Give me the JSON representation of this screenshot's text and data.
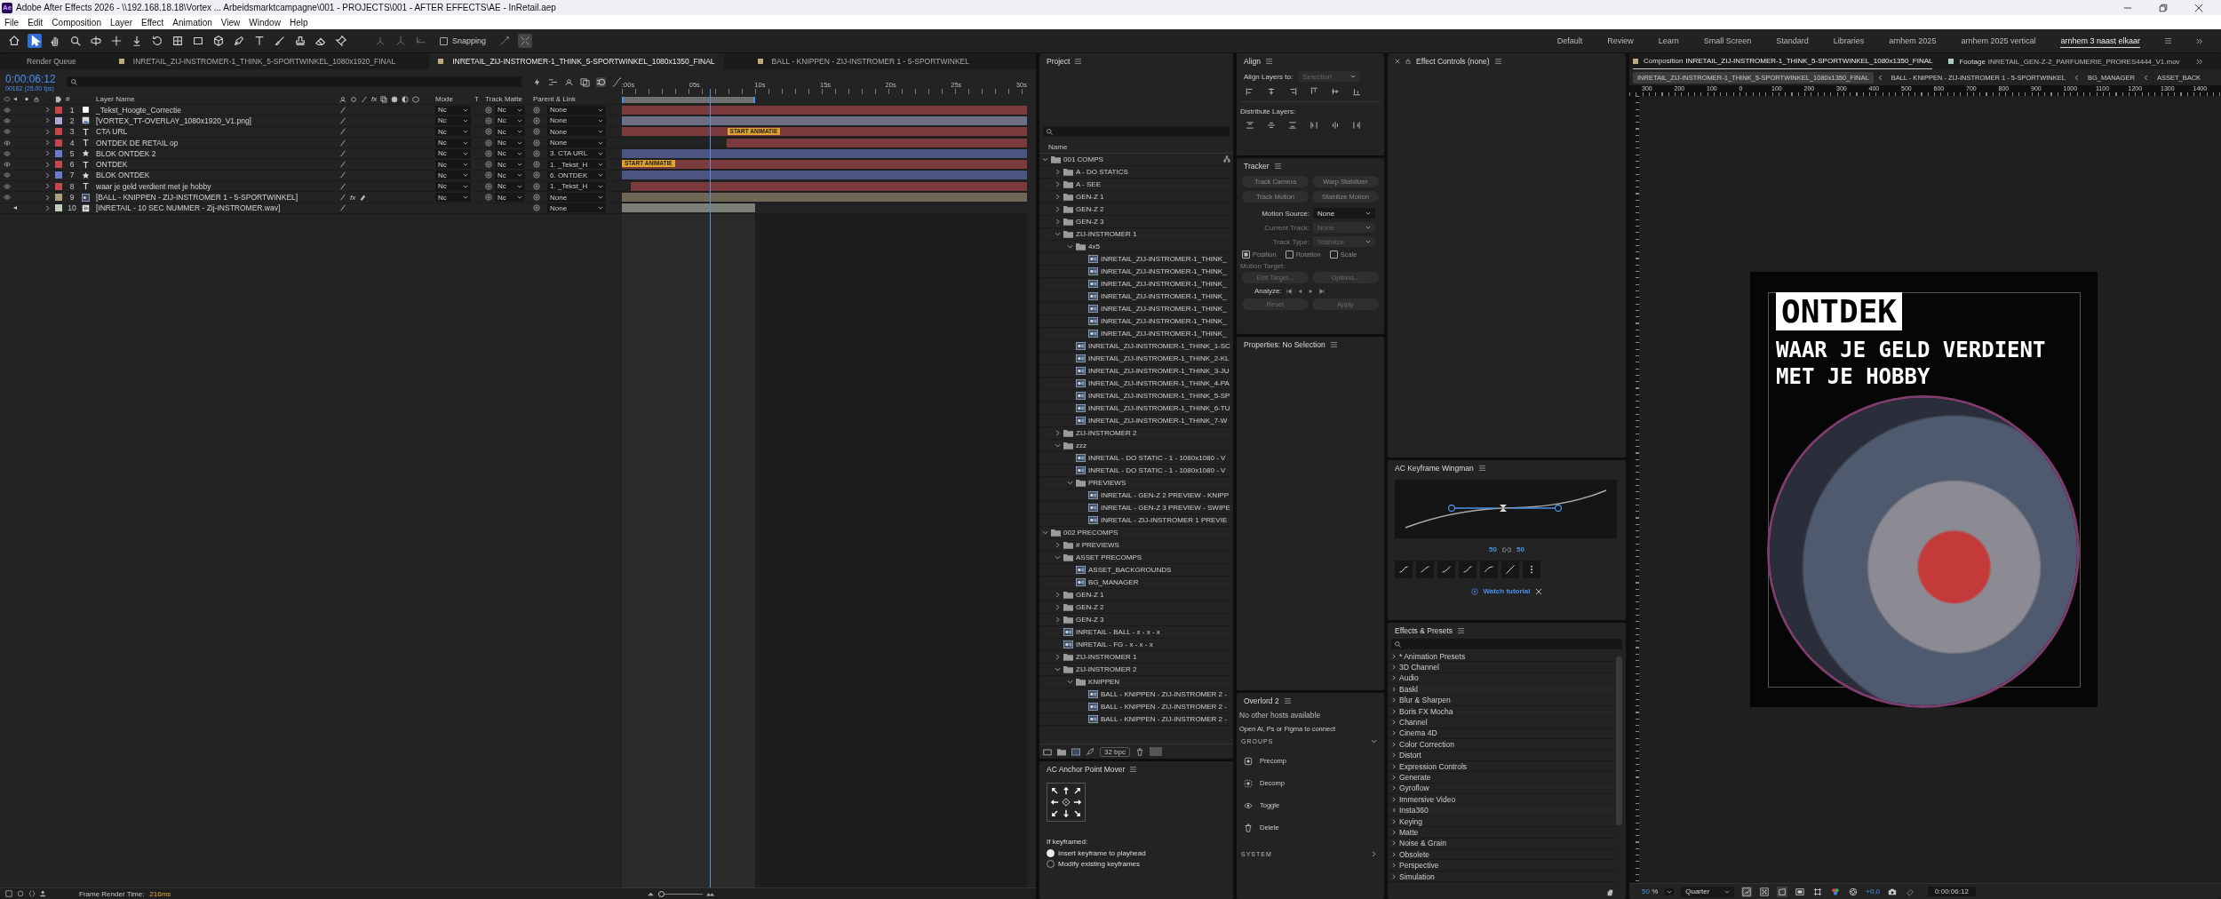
{
  "window": {
    "app_icon": "Ae",
    "title": "Adobe After Effects 2026 - \\\\192.168.18.18\\Vortex ... Arbeidsmarktcampagne\\001 - PROJECTS\\001 - AFTER EFFECTS\\AE - InRetail.aep"
  },
  "menu": [
    "File",
    "Edit",
    "Composition",
    "Layer",
    "Effect",
    "Animation",
    "View",
    "Window",
    "Help"
  ],
  "toolbar": {
    "tools": [
      {
        "selected": false
      },
      {
        "selected": true
      },
      {
        "selected": false
      },
      {
        "selected": false
      },
      {
        "selected": false
      },
      {
        "selected": false
      },
      {
        "selected": false
      },
      {
        "selected": false
      },
      {
        "selected": false
      },
      {
        "selected": false
      },
      {
        "selected": false
      },
      {
        "selected": false
      },
      {
        "selected": false
      },
      {
        "selected": false
      },
      {
        "selected": false
      },
      {
        "selected": false
      },
      {
        "selected": false
      }
    ],
    "snapping": {
      "label": "Snapping",
      "checked": false
    }
  },
  "workspaces": [
    {
      "label": "Default",
      "selected": false
    },
    {
      "label": "Review",
      "selected": false
    },
    {
      "label": "Learn",
      "selected": false
    },
    {
      "label": "Small Screen",
      "selected": false
    },
    {
      "label": "Standard",
      "selected": false
    },
    {
      "label": "Libraries",
      "selected": false
    },
    {
      "label": "arnhem 2025",
      "selected": false
    },
    {
      "label": "arnhem 2025 vertical",
      "selected": false
    },
    {
      "label": "arnhem 3 naast elkaar",
      "selected": true
    }
  ],
  "timeline": {
    "tabs": [
      {
        "label": "Render Queue",
        "kind": "queue",
        "selected": false
      },
      {
        "label": "INRETAIL_ZIJ-INSTROMER-1_THINK_5-SPORTWINKEL_1080x1920_FINAL",
        "kind": "comp",
        "selected": false
      },
      {
        "label": "INRETAIL_ZIJ-INSTROMER-1_THINK_5-SPORTWINKEL_1080x1350_FINAL",
        "kind": "comp",
        "selected": true
      },
      {
        "label": "BALL - KNIPPEN - ZIJ-INSTROMER 1 - 5-SPORTWINKEL",
        "kind": "comp",
        "selected": false
      }
    ],
    "timecode": "0:00:06:12",
    "frame_info": "00162 (25.00 fps)",
    "columns": {
      "number": "#",
      "layer_name": "Layer Name",
      "fx": "fx",
      "mode": "Mode",
      "t": "T",
      "track_matte": "Track Matte",
      "parent": "Parent & Link"
    },
    "ruler": [
      ":00s",
      "05s",
      "10s",
      "15s",
      "20s",
      "25s",
      "30s"
    ],
    "layers": [
      {
        "number": "1",
        "name": "_Tekst_Hoogte_Correctie",
        "kind": "solid",
        "color": "#c4474b",
        "enabled": true,
        "mode": "Nc",
        "matte": "Nc",
        "parent": "None"
      },
      {
        "number": "2",
        "name": "[VORTEX_TT-OVERLAY_1080x1920_V1.png]",
        "kind": "footage",
        "color": "#a9aad4",
        "enabled": true,
        "mode": "Nc",
        "matte": "Nc",
        "parent": "None"
      },
      {
        "number": "3",
        "name": "CTA URL",
        "kind": "text",
        "color": "#c4474b",
        "enabled": true,
        "mode": "Nc",
        "matte": "Nc",
        "parent": "None",
        "marker": "START ANIMATIE"
      },
      {
        "number": "4",
        "name": "ONTDEK DE RETAIL op",
        "kind": "text",
        "color": "#c4474b",
        "enabled": true,
        "mode": "Nc",
        "matte": "Nc",
        "parent": "None"
      },
      {
        "number": "5",
        "name": "BLOK ONTDEK 2",
        "kind": "shape",
        "color": "#6b7ad1",
        "enabled": true,
        "mode": "Nc",
        "matte": "Nc",
        "parent": "3. CTA URL"
      },
      {
        "number": "6",
        "name": "ONTDEK",
        "kind": "text",
        "color": "#c4474b",
        "enabled": true,
        "mode": "Nc",
        "matte": "Nc",
        "parent": "1. _Tekst_H",
        "marker": "START ANIMATIE"
      },
      {
        "number": "7",
        "name": "BLOK ONTDEK",
        "kind": "shape",
        "color": "#6b7ad1",
        "enabled": true,
        "mode": "Nc",
        "matte": "Nc",
        "parent": "6. ONTDEK"
      },
      {
        "number": "8",
        "name": "waar je geld verdient met je hobby",
        "kind": "text",
        "color": "#c4474b",
        "enabled": true,
        "mode": "Nc",
        "matte": "Nc",
        "parent": "1. _Tekst_H"
      },
      {
        "number": "9",
        "name": "[BALL - KNIPPEN - ZIJ-INSTROMER 1 - 5-SPORTWINKEL]",
        "kind": "precomp",
        "color": "#b09f7d",
        "enabled": true,
        "fx": "fx",
        "mode": "Nc",
        "matte": "Nc",
        "parent": "None"
      },
      {
        "number": "10",
        "name": "[INRETAIL - 10 SEC NUMMER - Zij-INSTROMER.wav]",
        "kind": "audio",
        "color": "#c3cdbd",
        "enabled": true,
        "parent": "None"
      }
    ],
    "status": {
      "label": "Frame Render Time:",
      "value": "216ms"
    },
    "zoom_slider": {
      "level": 0.05
    }
  },
  "project": {
    "title": "Project",
    "column": "Name",
    "bpc": "32 bpc",
    "tree": [
      {
        "name": "001 COMPS",
        "kind": "folder",
        "expanded": true,
        "children": [
          {
            "name": "A - DO STATICS",
            "kind": "folder",
            "expanded": false
          },
          {
            "name": "A - SEE",
            "kind": "folder",
            "expanded": false
          },
          {
            "name": "GEN-Z 1",
            "kind": "folder",
            "expanded": false
          },
          {
            "name": "GEN-Z 2",
            "kind": "folder",
            "expanded": false
          },
          {
            "name": "GEN-Z 3",
            "kind": "folder",
            "expanded": false
          },
          {
            "name": "ZIJ-INSTROMER 1",
            "kind": "folder",
            "expanded": true,
            "children": [
              {
                "name": "4x5",
                "kind": "folder",
                "expanded": true,
                "children": [
                  {
                    "name": "INRETAIL_ZIJ-INSTROMER-1_THINK_",
                    "kind": "comp"
                  },
                  {
                    "name": "INRETAIL_ZIJ-INSTROMER-1_THINK_",
                    "kind": "comp"
                  },
                  {
                    "name": "INRETAIL_ZIJ-INSTROMER-1_THINK_",
                    "kind": "comp"
                  },
                  {
                    "name": "INRETAIL_ZIJ-INSTROMER-1_THINK_",
                    "kind": "comp"
                  },
                  {
                    "name": "INRETAIL_ZIJ-INSTROMER-1_THINK_",
                    "kind": "comp"
                  },
                  {
                    "name": "INRETAIL_ZIJ-INSTROMER-1_THINK_",
                    "kind": "comp"
                  },
                  {
                    "name": "INRETAIL_ZIJ-INSTROMER-1_THINK_",
                    "kind": "comp"
                  }
                ]
              },
              {
                "name": "INRETAIL_ZIJ-INSTROMER-1_THINK_1-SC",
                "kind": "comp"
              },
              {
                "name": "INRETAIL_ZIJ-INSTROMER-1_THINK_2-KL",
                "kind": "comp"
              },
              {
                "name": "INRETAIL_ZIJ-INSTROMER-1_THINK_3-JU",
                "kind": "comp"
              },
              {
                "name": "INRETAIL_ZIJ-INSTROMER-1_THINK_4-PA",
                "kind": "comp"
              },
              {
                "name": "INRETAIL_ZIJ-INSTROMER-1_THINK_5-SP",
                "kind": "comp"
              },
              {
                "name": "INRETAIL_ZIJ-INSTROMER-1_THINK_6-TU",
                "kind": "comp"
              },
              {
                "name": "INRETAIL_ZIJ-INSTROMER-1_THINK_7-W",
                "kind": "comp"
              }
            ]
          },
          {
            "name": "ZIJ-INSTROMER 2",
            "kind": "folder",
            "expanded": false
          },
          {
            "name": "zzz",
            "kind": "folder",
            "expanded": true,
            "children": [
              {
                "name": "INRETAIL - DO STATIC - 1 - 1080x1080 - V",
                "kind": "comp"
              },
              {
                "name": "INRETAIL - DO STATIC - 1 - 1080x1080 - V",
                "kind": "comp"
              },
              {
                "name": "PREVIEWS",
                "kind": "folder",
                "expanded": true,
                "children": [
                  {
                    "name": "INRETAIL - GEN-Z 2 PREVIEW - KNIPP",
                    "kind": "comp"
                  },
                  {
                    "name": "INRETAIL - GEN-Z 3 PREVIEW - SWIPE",
                    "kind": "comp"
                  },
                  {
                    "name": "INRETAIL - ZIJ-INSTROMER 1 PREVIE",
                    "kind": "comp"
                  }
                ]
              }
            ]
          }
        ]
      },
      {
        "name": "002 PRECOMPS",
        "kind": "folder",
        "expanded": true,
        "children": [
          {
            "name": "# PREVIEWS",
            "kind": "folder",
            "expanded": false
          },
          {
            "name": "ASSET PRECOMPS",
            "kind": "folder",
            "expanded": true,
            "children": [
              {
                "name": "ASSET_BACKGROUNDS",
                "kind": "comp"
              },
              {
                "name": "BG_MANAGER",
                "kind": "comp"
              }
            ]
          },
          {
            "name": "GEN-Z 1",
            "kind": "folder",
            "expanded": false
          },
          {
            "name": "GEN-Z 2",
            "kind": "folder",
            "expanded": false
          },
          {
            "name": "GEN-Z 3",
            "kind": "folder",
            "expanded": false
          },
          {
            "name": "INRETAIL - BALL - x - x - x",
            "kind": "comp"
          },
          {
            "name": "INRETAIL - FG - x - x - x",
            "kind": "comp"
          },
          {
            "name": "ZIJ-INSTROMER 1",
            "kind": "folder",
            "expanded": false
          },
          {
            "name": "ZIJ-INSTROMER 2",
            "kind": "folder",
            "expanded": true,
            "children": [
              {
                "name": "KNIPPEN",
                "kind": "folder",
                "expanded": true,
                "children": [
                  {
                    "name": "BALL - KNIPPEN - ZIJ-INSTROMER 2 -",
                    "kind": "comp"
                  },
                  {
                    "name": "BALL - KNIPPEN - ZIJ-INSTROMER 2 -",
                    "kind": "comp"
                  },
                  {
                    "name": "BALL - KNIPPEN - ZIJ-INSTROMER 2 -",
                    "kind": "comp"
                  }
                ]
              }
            ]
          }
        ]
      }
    ]
  },
  "anchor_mover": {
    "title": "AC Anchor Point Mover",
    "label": "If keyframed:",
    "options": [
      {
        "label": "Insert keyframe to playhead",
        "selected": true
      },
      {
        "label": "Modify existing keyframes",
        "selected": false
      }
    ]
  },
  "align": {
    "title": "Align",
    "align_to_label": "Align Layers to:",
    "align_to": "Selection",
    "distribute_label": "Distribute Layers:"
  },
  "tracker": {
    "title": "Tracker",
    "buttons": [
      "Track Camera",
      "Warp Stabilizer",
      "Track Motion",
      "Stabilize Motion"
    ],
    "fields": [
      {
        "label": "Motion Source:",
        "value": "None",
        "disabled": false
      },
      {
        "label": "Current Track:",
        "value": "None",
        "disabled": true
      },
      {
        "label": "Track Type:",
        "value": "Stabilize",
        "disabled": true
      }
    ],
    "options": [
      {
        "label": "Position",
        "checked": true
      },
      {
        "label": "Rotation",
        "checked": false
      },
      {
        "label": "Scale",
        "checked": false
      }
    ],
    "motion_target": "Motion Target:",
    "target_buttons": [
      "Edit Target...",
      "Options..."
    ],
    "analyze": "Analyze:",
    "actions": [
      "Reset",
      "Apply"
    ]
  },
  "properties": {
    "title": "Properties: No Selection"
  },
  "overlord": {
    "title": "Overlord 2",
    "message": "No other hosts available",
    "hint": "Open Ai, Ps or Figma to connect",
    "groups_label": "GROUPS",
    "actions": [
      "Precomp",
      "Decomp",
      "Toggle",
      "Delete"
    ],
    "system_label": "SYSTEM"
  },
  "effect_controls": {
    "title": "Effect Controls (none)"
  },
  "wingman": {
    "title": "AC Keyframe Wingman",
    "influence_in": "50",
    "influence_out": "50",
    "tutorial": "Watch tutorial"
  },
  "effects_presets": {
    "title": "Effects & Presets",
    "items": [
      "* Animation Presets",
      "3D Channel",
      "Audio",
      "Baskl",
      "Blur & Sharpen",
      "Boris FX Mocha",
      "Channel",
      "Cinema 4D",
      "Color Correction",
      "Distort",
      "Expression Controls",
      "Generate",
      "Gyroflow",
      "Immersive Video",
      "Insta360",
      "Keying",
      "Matte",
      "Noise & Grain",
      "Obsolete",
      "Perspective",
      "Simulation"
    ]
  },
  "composition": {
    "tabs": [
      {
        "prefix": "Composition",
        "label": "INRETAIL_ZIJ-INSTROMER-1_THINK_5-SPORTWINKEL_1080x1350_FINAL",
        "selected": true
      },
      {
        "prefix": "Footage",
        "label": "INRETAIL_GEN-Z-2_PARFUMERIE_PRORES4444_V1.mov",
        "selected": false
      }
    ],
    "breadcrumbs": [
      {
        "label": "INRETAIL_ZIJ-INSTROMER-1_THINK_5-SPORTWINKEL_1080x1350_FINAL",
        "selected": true
      },
      {
        "label": "BALL - KNIPPEN - ZIJ-INSTROMER 1 - 5-SPORTWINKEL",
        "selected": false
      },
      {
        "label": "BG_MANAGER",
        "selected": false
      },
      {
        "label": "ASSET_BACK",
        "selected": false
      }
    ],
    "ruler": [
      "300",
      "200",
      "100",
      "0",
      "100",
      "200",
      "300",
      "400",
      "500",
      "600",
      "700",
      "800",
      "900",
      "1000",
      "1100",
      "1200",
      "1300",
      "1400"
    ],
    "canvas": {
      "badge": "ONTDEK",
      "lines": [
        "WAAR JE GELD VERDIENT",
        "MET JE HOBBY"
      ]
    },
    "zoom": "50",
    "zoom_unit": "%",
    "resolution": "Quarter",
    "exposure": "+0,0",
    "timecode": "0:00:06:12"
  }
}
